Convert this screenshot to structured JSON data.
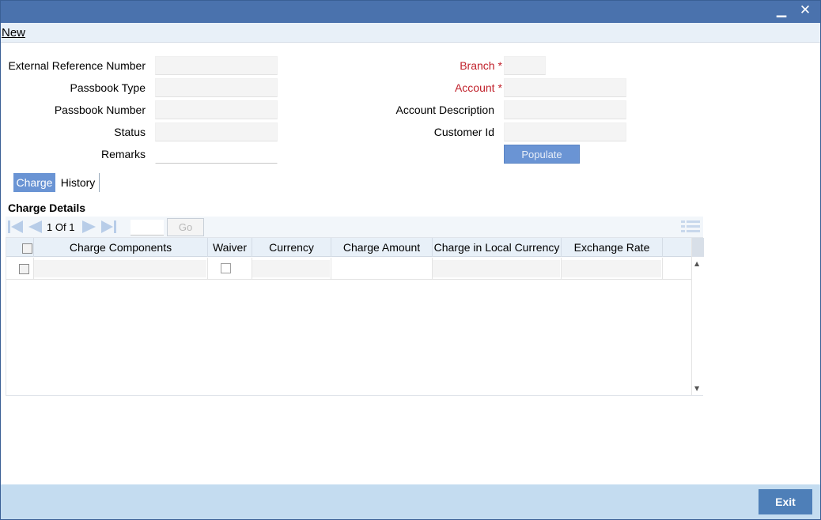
{
  "window": {
    "minimize_icon": "minimize-icon",
    "close_icon": "close-icon",
    "minimize_glyph": "▁",
    "close_glyph": "✕"
  },
  "menu": {
    "new_label": "New"
  },
  "form": {
    "external_reference_number": {
      "label": "External Reference Number",
      "value": ""
    },
    "passbook_type": {
      "label": "Passbook Type",
      "value": ""
    },
    "passbook_number": {
      "label": "Passbook Number",
      "value": ""
    },
    "status": {
      "label": "Status",
      "value": ""
    },
    "remarks": {
      "label": "Remarks",
      "value": ""
    },
    "branch": {
      "label": "Branch",
      "required_mark": "*",
      "value": ""
    },
    "account": {
      "label": "Account",
      "required_mark": "*",
      "value": ""
    },
    "account_description": {
      "label": "Account Description",
      "value": ""
    },
    "customer_id": {
      "label": "Customer Id",
      "value": ""
    },
    "populate_label": "Populate"
  },
  "tabs": [
    {
      "label": "Charge",
      "active": true
    },
    {
      "label": "History",
      "active": false
    }
  ],
  "charge_details": {
    "title": "Charge Details",
    "pager": {
      "current": "1",
      "of_label": "Of",
      "total": "1",
      "go_label": "Go",
      "page_input": ""
    },
    "columns": [
      "Charge Components",
      "Waiver",
      "Currency",
      "Charge Amount",
      "Charge in Local Currency",
      "Exchange Rate"
    ],
    "rows": [
      {
        "charge_components": "",
        "waiver": false,
        "currency": "",
        "charge_amount": "",
        "charge_in_local_currency": "",
        "exchange_rate": ""
      }
    ]
  },
  "footer": {
    "exit_label": "Exit"
  },
  "colors": {
    "titlebar": "#4a72ad",
    "accent_button": "#6a94d4",
    "required_label": "#c0202a",
    "footer": "#c4dcf0",
    "exit_button": "#4e7fb8"
  }
}
